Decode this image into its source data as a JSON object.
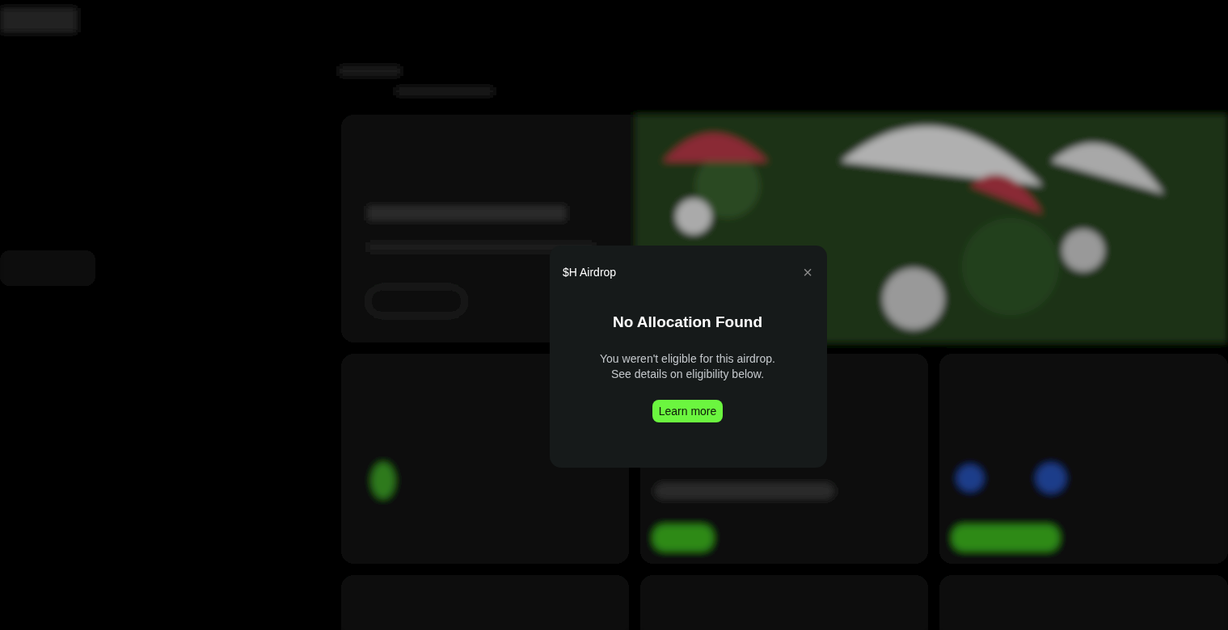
{
  "dialog": {
    "title": "$H Airdrop",
    "close": "×",
    "heading": "No Allocation Found",
    "message_lines": [
      "You weren't eligible for this airdrop.",
      "See details on eligibility below."
    ],
    "button": "Learn more"
  }
}
